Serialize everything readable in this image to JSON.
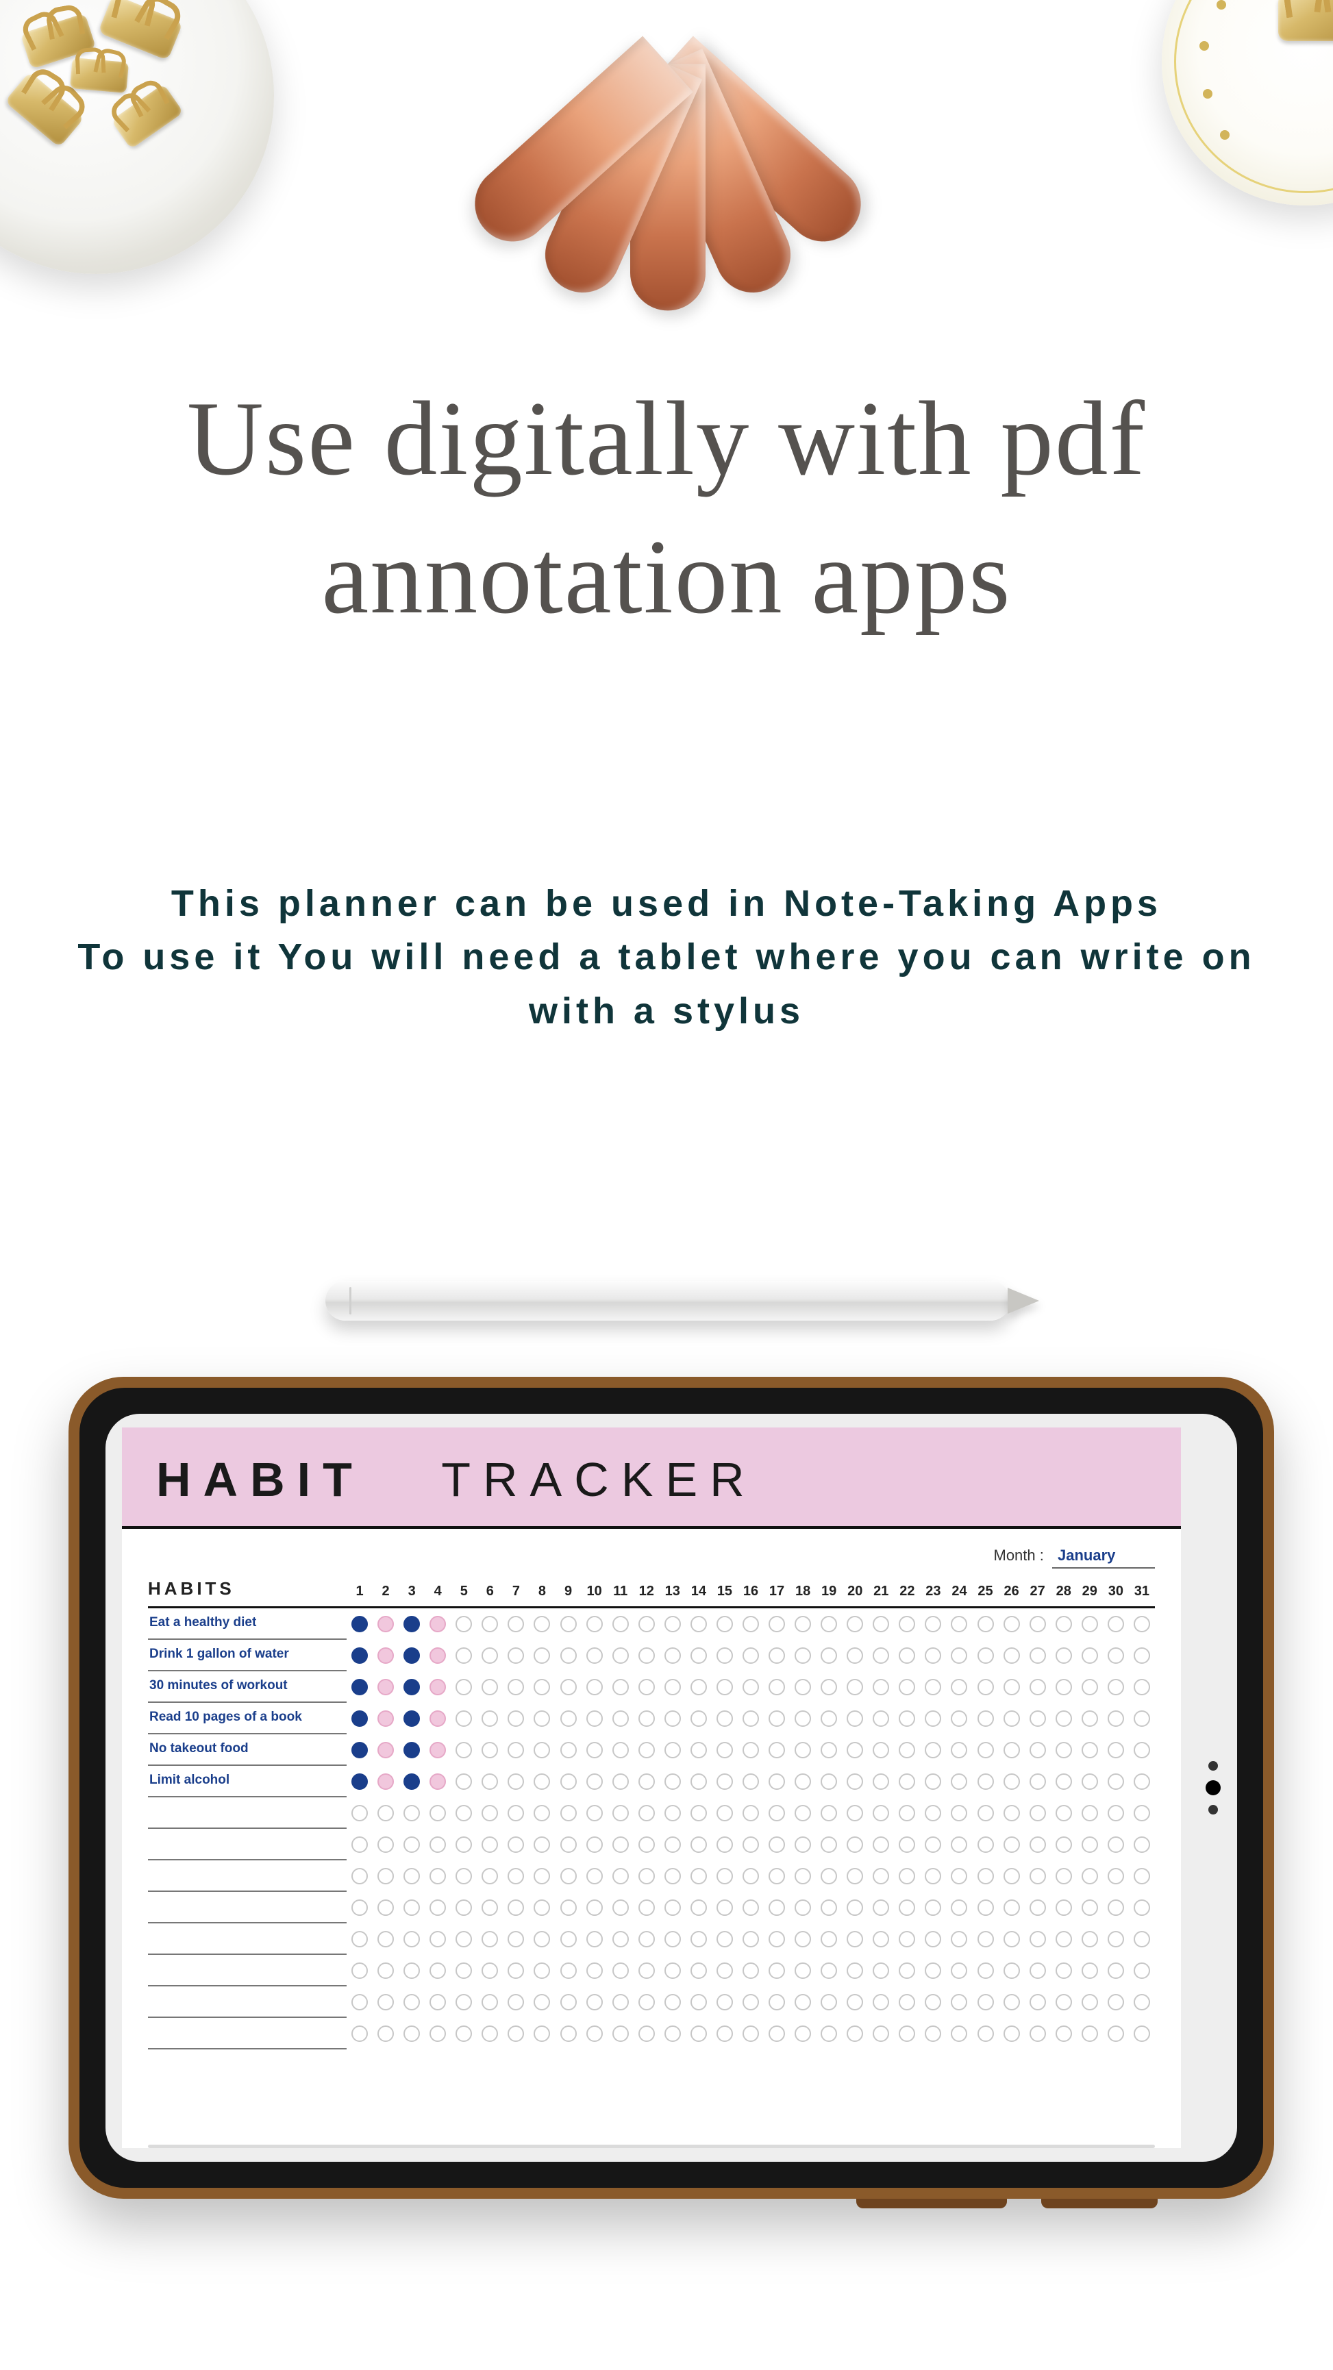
{
  "headline_line1": "Use digitally with pdf",
  "headline_line2": "annotation apps",
  "subtitle_line1": "This planner can be used in Note-Taking Apps",
  "subtitle_line2": "To use it You will need a tablet where you can write on",
  "subtitle_line3": "with a stylus",
  "tracker": {
    "title_bold": "HABIT",
    "title_light": "TRACKER",
    "month_label": "Month :",
    "month_value": "January",
    "habits_col_header": "HABITS",
    "days": [
      "1",
      "2",
      "3",
      "4",
      "5",
      "6",
      "7",
      "8",
      "9",
      "10",
      "11",
      "12",
      "13",
      "14",
      "15",
      "16",
      "17",
      "18",
      "19",
      "20",
      "21",
      "22",
      "23",
      "24",
      "25",
      "26",
      "27",
      "28",
      "29",
      "30",
      "31"
    ],
    "rows": [
      {
        "label": "Eat a healthy diet",
        "marks": [
          "blue",
          "pink",
          "blue",
          "pink"
        ]
      },
      {
        "label": "Drink 1 gallon of water",
        "marks": [
          "blue",
          "pink",
          "blue",
          "pink"
        ]
      },
      {
        "label": "30 minutes of workout",
        "marks": [
          "blue",
          "pink",
          "blue",
          "pink"
        ]
      },
      {
        "label": "Read 10 pages of a book",
        "marks": [
          "blue",
          "pink",
          "blue",
          "pink"
        ]
      },
      {
        "label": "No takeout food",
        "marks": [
          "blue",
          "pink",
          "blue",
          "pink"
        ]
      },
      {
        "label": "Limit alcohol",
        "marks": [
          "blue",
          "pink",
          "blue",
          "pink"
        ]
      },
      {
        "label": "",
        "marks": []
      },
      {
        "label": "",
        "marks": []
      },
      {
        "label": "",
        "marks": []
      },
      {
        "label": "",
        "marks": []
      },
      {
        "label": "",
        "marks": []
      },
      {
        "label": "",
        "marks": []
      },
      {
        "label": "",
        "marks": []
      },
      {
        "label": "",
        "marks": []
      }
    ]
  }
}
